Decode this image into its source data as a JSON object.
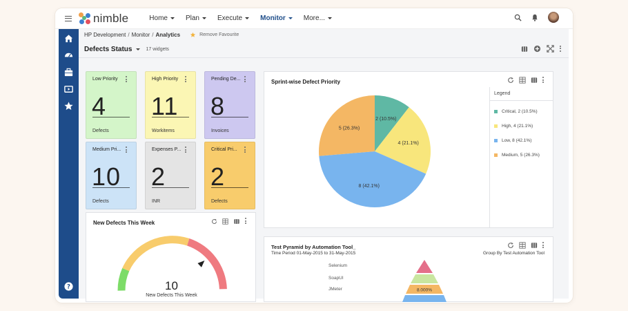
{
  "app": {
    "logo_text": "nimble"
  },
  "nav": [
    {
      "label": "Home"
    },
    {
      "label": "Plan"
    },
    {
      "label": "Execute"
    },
    {
      "label": "Monitor"
    },
    {
      "label": "More..."
    }
  ],
  "breadcrumb": {
    "items": [
      "HP Development",
      "Monitor"
    ],
    "current": "Analytics",
    "separator": "/",
    "favourite_label": "Remove Favourite"
  },
  "dashboard": {
    "title": "Defects Status",
    "widget_count": "17 widgets"
  },
  "tiles": [
    {
      "label": "Low Priority",
      "value": "4",
      "unit": "Defects",
      "color": "#d4f5c9"
    },
    {
      "label": "High Priority",
      "value": "11",
      "unit": "Workitems",
      "color": "#fbf6b4"
    },
    {
      "label": "Pending De...",
      "value": "8",
      "unit": "Invoices",
      "color": "#cdc8f0"
    },
    {
      "label": "Medium Pri...",
      "value": "10",
      "unit": "Defects",
      "color": "#cce3f7"
    },
    {
      "label": "Expenses P...",
      "value": "2",
      "unit": "INR",
      "color": "#e4e4e4"
    },
    {
      "label": "Critical Pri...",
      "value": "2",
      "unit": "Defects",
      "color": "#f8cc6c"
    }
  ],
  "gauge": {
    "title": "New Defects This Week",
    "value": "10",
    "caption": "New Defects This Week",
    "fraction": 0.79
  },
  "pie": {
    "title": "Sprint-wise Defect Priority",
    "legend_title": "Legend"
  },
  "chart_data": {
    "type": "pie",
    "title": "Sprint-wise Defect Priority",
    "slices": [
      {
        "name": "Critical",
        "value": 2,
        "label": "2 (10.5%)",
        "legend": "Critical, 2 (10.5%)",
        "color": "#5fb8a4"
      },
      {
        "name": "High",
        "value": 4,
        "label": "4 (21.1%)",
        "legend": "High, 4 (21.1%)",
        "color": "#f8e67c"
      },
      {
        "name": "Low",
        "value": 8,
        "label": "8 (42.1%)",
        "legend": "Low, 8 (42.1%)",
        "color": "#78b4ee"
      },
      {
        "name": "Medium",
        "value": 5,
        "label": "5 (26.3%)",
        "legend": "Medium, 5 (26.3%)",
        "color": "#f4b764"
      }
    ],
    "legend_position": "right"
  },
  "pyramid": {
    "title": "Test Pyramid by Automation Tool_",
    "period": "Time Period 01-May-2015 to 31-May-2015",
    "group_by": "Group By Test Automation Tool",
    "labels": [
      "Selenium",
      "SoapUI",
      "JMeter"
    ],
    "level_value": "8.000%",
    "colors": [
      "#e46f8a",
      "#c9e6a0",
      "#f4b764",
      "#78b4ee"
    ]
  },
  "colors": {
    "sidebar": "#1e4c8a",
    "accent": "#1f4e8a"
  }
}
